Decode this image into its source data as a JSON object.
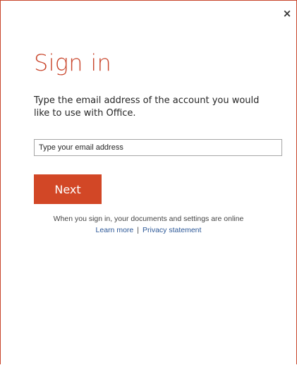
{
  "dialog": {
    "close_glyph": "×",
    "title": "Sign in",
    "description": "Type the email address of the account you would like to use with Office.",
    "email_input": {
      "value": "",
      "placeholder": "Type your email address"
    },
    "next_label": "Next",
    "footer": {
      "notice": "When you sign in, your documents and settings are online",
      "learn_more": "Learn more",
      "separator": "|",
      "privacy": "Privacy statement"
    }
  },
  "colors": {
    "accent": "#d24726",
    "title": "#c9462c",
    "link": "#2b5797",
    "border": "#c9462c"
  },
  "icons": {
    "close": "close-icon"
  }
}
